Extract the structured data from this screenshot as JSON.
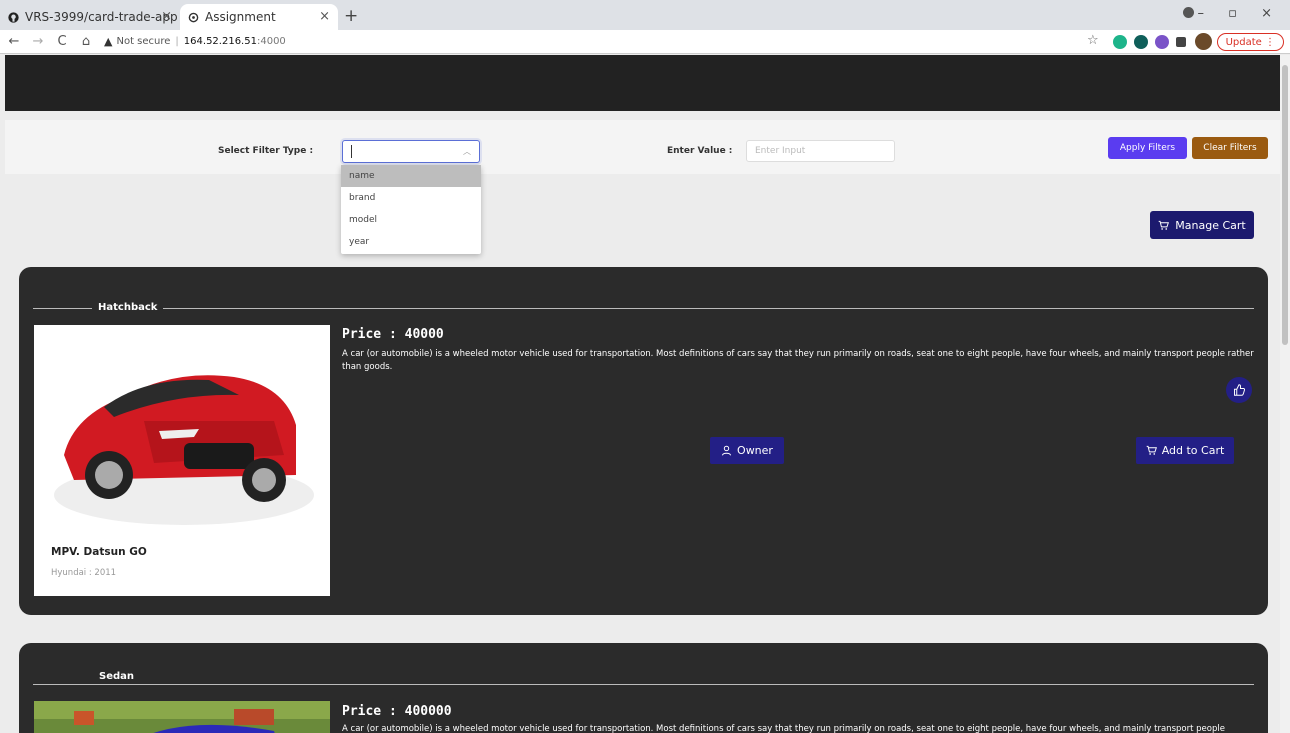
{
  "browser": {
    "tabs": [
      {
        "title": "VRS-3999/card-trade-app",
        "close": "×"
      },
      {
        "title": "Assignment",
        "close": "×"
      }
    ],
    "new_tab": "+",
    "address": {
      "security": "Not secure",
      "host": "164.52.216.51",
      "port": ":4000"
    },
    "update_label": "Update"
  },
  "filters": {
    "type_label": "Select Filter Type :",
    "value_label": "Enter Value :",
    "value_placeholder": "Enter Input",
    "options": [
      "name",
      "brand",
      "model",
      "year"
    ],
    "highlighted_option": "name",
    "apply_label": "Apply Filters",
    "clear_label": "Clear Filters"
  },
  "cart": {
    "manage_label": "Manage Cart"
  },
  "listings": [
    {
      "category": "Hatchback",
      "price": "Price : 40000",
      "description": "A car (or automobile) is a wheeled motor vehicle used for transportation. Most definitions of cars say that they run primarily on roads, seat one to eight people, have four wheels, and mainly transport people rather than goods.",
      "car_name": "MPV. Datsun GO",
      "car_meta": "Hyundai : 2011",
      "owner_label": "Owner",
      "add_label": "Add to Cart"
    },
    {
      "category": "Sedan",
      "price": "Price : 400000",
      "description": "A car (or automobile) is a wheeled motor vehicle used for transportation. Most definitions of cars say that they run primarily on roads, seat one to eight people, have four wheels, and mainly transport people"
    }
  ],
  "colors": {
    "accent": "#231f86",
    "apply": "#5a3cf0",
    "clear": "#9a5a10",
    "card_bg": "#2b2b2b",
    "header": "#222222"
  }
}
